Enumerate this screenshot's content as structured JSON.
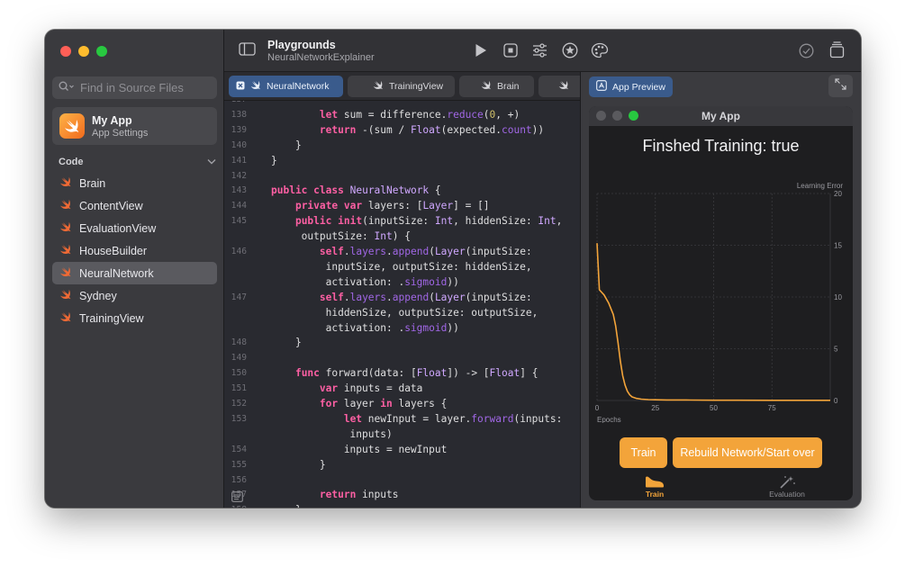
{
  "sidebar": {
    "search_placeholder": "Find in Source Files",
    "app_card": {
      "title": "My App",
      "subtitle": "App Settings"
    },
    "section_title": "Code",
    "files": [
      {
        "label": "Brain",
        "selected": false
      },
      {
        "label": "ContentView",
        "selected": false
      },
      {
        "label": "EvaluationView",
        "selected": false
      },
      {
        "label": "HouseBuilder",
        "selected": false
      },
      {
        "label": "NeuralNetwork",
        "selected": true
      },
      {
        "label": "Sydney",
        "selected": false
      },
      {
        "label": "TrainingView",
        "selected": false
      }
    ]
  },
  "toolbar": {
    "title": "Playgrounds",
    "subtitle": "NeuralNetworkExplainer"
  },
  "tabs": [
    {
      "label": "NeuralNetwork",
      "active": true
    },
    {
      "label": "TrainingView",
      "active": false
    },
    {
      "label": "Brain",
      "active": false
    },
    {
      "label": "",
      "active": false
    }
  ],
  "editor": {
    "lines": [
      {
        "n": "137",
        "code": ""
      },
      {
        "n": "138",
        "code": "        let sum = difference.reduce(0, +)"
      },
      {
        "n": "139",
        "code": "        return -(sum / Float(expected.count))"
      },
      {
        "n": "140",
        "code": "    }"
      },
      {
        "n": "141",
        "code": "}"
      },
      {
        "n": "142",
        "code": ""
      },
      {
        "n": "143",
        "code": "public class NeuralNetwork {"
      },
      {
        "n": "144",
        "code": "    private var layers: [Layer] = []"
      },
      {
        "n": "145",
        "code": "    public init(inputSize: Int, hiddenSize: Int,"
      },
      {
        "n": "",
        "code": "     outputSize: Int) {"
      },
      {
        "n": "146",
        "code": "        self.layers.append(Layer(inputSize:"
      },
      {
        "n": "",
        "code": "         inputSize, outputSize: hiddenSize,"
      },
      {
        "n": "",
        "code": "         activation: .sigmoid))"
      },
      {
        "n": "147",
        "code": "        self.layers.append(Layer(inputSize:"
      },
      {
        "n": "",
        "code": "         hiddenSize, outputSize: outputSize,"
      },
      {
        "n": "",
        "code": "         activation: .sigmoid))"
      },
      {
        "n": "148",
        "code": "    }"
      },
      {
        "n": "149",
        "code": ""
      },
      {
        "n": "150",
        "code": "    func forward(data: [Float]) -> [Float] {"
      },
      {
        "n": "151",
        "code": "        var inputs = data"
      },
      {
        "n": "152",
        "code": "        for layer in layers {"
      },
      {
        "n": "153",
        "code": "            let newInput = layer.forward(inputs:"
      },
      {
        "n": "",
        "code": "             inputs)"
      },
      {
        "n": "154",
        "code": "            inputs = newInput"
      },
      {
        "n": "155",
        "code": "        }"
      },
      {
        "n": "156",
        "code": ""
      },
      {
        "n": "157",
        "code": "        return inputs"
      },
      {
        "n": "158",
        "code": "    }"
      }
    ]
  },
  "preview": {
    "tab_label": "App Preview",
    "window_title": "My App",
    "status": "Finshed Training: true",
    "train_button": "Train",
    "rebuild_button": "Rebuild Network/Start over",
    "bottom_tabs": [
      {
        "label": "Train",
        "active": true
      },
      {
        "label": "Evaluation",
        "active": false
      }
    ]
  },
  "colors": {
    "accent": "#f3a43a",
    "active_tab": "#3a5b8c",
    "editor_bg": "#292a30"
  },
  "chart_data": {
    "type": "line",
    "ylabel": "Learning Error",
    "xlabel": "Epochs",
    "xlim": [
      0,
      100
    ],
    "ylim": [
      0,
      20
    ],
    "x_ticks": [
      0,
      25,
      50,
      75
    ],
    "y_ticks": [
      0,
      5,
      10,
      15,
      20
    ],
    "grid": true,
    "series": [
      {
        "color": "#f3a43a",
        "x": [
          0,
          1,
          3,
          5,
          7,
          8,
          9,
          10,
          11,
          12,
          13,
          14,
          15,
          17,
          19,
          22,
          25,
          30,
          40,
          50,
          60,
          75,
          90,
          100
        ],
        "values": [
          15.2,
          10.7,
          10.2,
          9.4,
          8.3,
          7.2,
          5.6,
          3.8,
          2.4,
          1.5,
          0.9,
          0.55,
          0.35,
          0.2,
          0.13,
          0.09,
          0.07,
          0.05,
          0.04,
          0.03,
          0.03,
          0.02,
          0.02,
          0.02
        ]
      }
    ]
  }
}
